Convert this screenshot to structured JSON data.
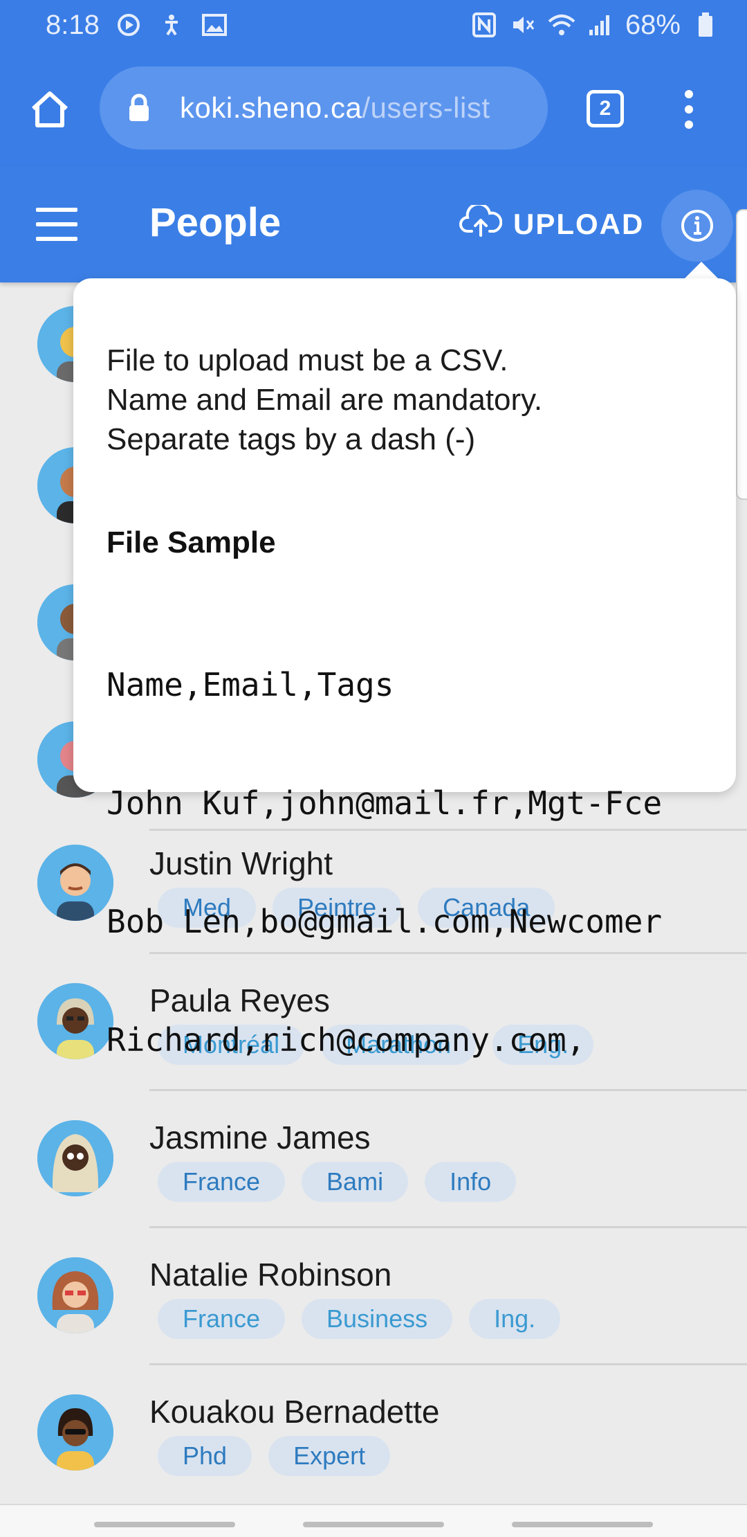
{
  "status_bar": {
    "time": "8:18",
    "battery": "68%"
  },
  "browser": {
    "url_host": "koki.sheno.ca",
    "url_path": "/users-list",
    "tab_count": "2"
  },
  "app_bar": {
    "title": "People",
    "upload_label": "UPLOAD"
  },
  "popover": {
    "lines": [
      "File to upload must be a CSV.",
      "Name and Email are mandatory.",
      "Separate tags by a dash (-)"
    ],
    "sample_heading": "File Sample",
    "sample_lines": [
      "Name,Email,Tags",
      "John Kuf,john@mail.fr,Mgt-Fce",
      "Bob Len,bo@gmail.com,Newcomer",
      "Richard,rich@company.com,"
    ]
  },
  "people": [
    {
      "name": "Justin Wright",
      "tags": [
        "Med",
        "Peintre",
        "Canada"
      ]
    },
    {
      "name": "Paula Reyes",
      "tags": [
        "Montréal",
        "Marathon",
        "Eng."
      ]
    },
    {
      "name": "Jasmine James",
      "tags": [
        "France",
        "Bami",
        "Info"
      ]
    },
    {
      "name": "Natalie Robinson",
      "tags": [
        "France",
        "Business",
        "Ing."
      ]
    },
    {
      "name": "Kouakou Bernadette",
      "tags": [
        "Phd",
        "Expert"
      ]
    }
  ]
}
